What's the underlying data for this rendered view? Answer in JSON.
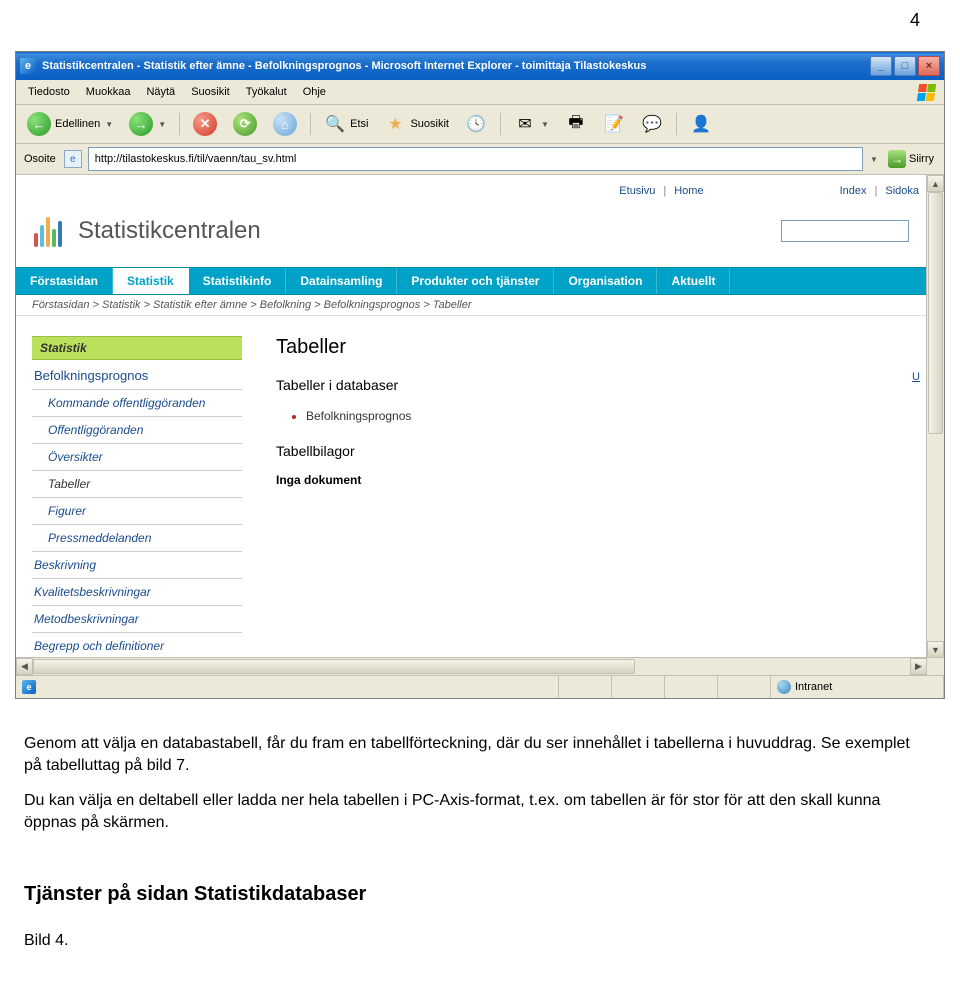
{
  "page_number": "4",
  "window": {
    "title": "Statistikcentralen - Statistik efter ämne - Befolkningsprognos - Microsoft Internet Explorer - toimittaja Tilastokeskus",
    "minimize": "_",
    "maximize": "□",
    "close": "×"
  },
  "menu": {
    "items": [
      "Tiedosto",
      "Muokkaa",
      "Näytä",
      "Suosikit",
      "Työkalut",
      "Ohje"
    ]
  },
  "toolbar": {
    "back": "Edellinen",
    "search": "Etsi",
    "favorites": "Suosikit"
  },
  "address": {
    "label": "Osoite",
    "url": "http://tilastokeskus.fi/til/vaenn/tau_sv.html",
    "go": "Siirry"
  },
  "top_links": {
    "etusivu": "Etusivu",
    "home": "Home",
    "index": "Index",
    "sidokarta": "Sidoka"
  },
  "brand": "Statistikcentralen",
  "nav": [
    "Förstasidan",
    "Statistik",
    "Statistikinfo",
    "Datainsamling",
    "Produkter och tjänster",
    "Organisation",
    "Aktuellt"
  ],
  "nav_active_index": 1,
  "breadcrumb": "Förstasidan > Statistik > Statistik efter ämne > Befolkning > Befolkningsprognos > Tabeller",
  "sidebar": {
    "heading": "Statistik",
    "section": "Befolkningsprognos",
    "items": [
      {
        "label": "Kommande offentliggöranden",
        "sub": true
      },
      {
        "label": "Offentliggöranden",
        "sub": true
      },
      {
        "label": "Översikter",
        "sub": true
      },
      {
        "label": "Tabeller",
        "sub": true,
        "current": true
      },
      {
        "label": "Figurer",
        "sub": true
      },
      {
        "label": "Pressmeddelanden",
        "sub": true
      },
      {
        "label": "Beskrivning",
        "sub": false
      },
      {
        "label": "Kvalitetsbeskrivningar",
        "sub": false
      },
      {
        "label": "Metodbeskrivningar",
        "sub": false
      },
      {
        "label": "Begrepp och definitioner",
        "sub": false
      }
    ]
  },
  "main": {
    "h1": "Tabeller",
    "h2a": "Tabeller i databaser",
    "list": [
      "Befolkningsprognos"
    ],
    "h2b": "Tabellbilagor",
    "nodocs": "Inga dokument"
  },
  "right_link": "U",
  "status": {
    "zone": "Intranet"
  },
  "description_paragraphs": [
    "Genom att välja en databastabell, får du fram en tabellförteckning, där du ser innehållet i tabellerna i huvuddrag. Se exemplet på tabelluttag på bild 7.",
    "Du kan välja en deltabell eller ladda ner hela tabellen i PC-Axis-format, t.ex. om tabellen är för stor för att den skall kunna öppnas på skärmen."
  ],
  "section_heading": "Tjänster på sidan Statistikdatabaser",
  "bild_label": "Bild 4."
}
